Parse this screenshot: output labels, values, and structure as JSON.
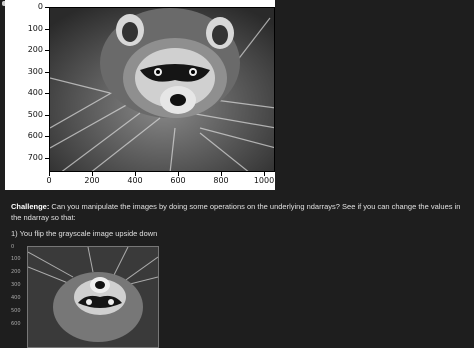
{
  "figure1": {
    "y_ticks": [
      "0",
      "100",
      "200",
      "300",
      "400",
      "500",
      "600",
      "700"
    ],
    "x_ticks": [
      "0",
      "200",
      "400",
      "600",
      "800",
      "1000"
    ]
  },
  "challenge": {
    "bold_label": "Challenge:",
    "text": " Can you manipulate the images by doing some operations on the underlying ndarrays? See if you can change the values in the ndarray so that:",
    "step1": "1) You flip the grayscale image upside down"
  },
  "figure2": {
    "y_ticks": [
      "0",
      "100",
      "200",
      "300",
      "400",
      "500",
      "600"
    ]
  }
}
